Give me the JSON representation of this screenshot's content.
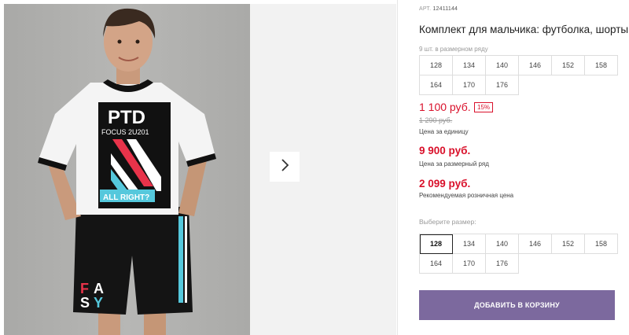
{
  "product": {
    "article_label": "АРТ.",
    "article": "12411144",
    "title": "Комплект для мальчика: футболка, шорты"
  },
  "pack": {
    "note": "9 шт. в размерном ряду",
    "sizes": [
      "128",
      "134",
      "140",
      "146",
      "152",
      "158",
      "164",
      "170",
      "176"
    ]
  },
  "prices": {
    "unit_price": "1 100 руб.",
    "discount": "15%",
    "old_price": "1 290 руб.",
    "unit_label": "Цена за единицу",
    "pack_price": "9 900 руб.",
    "pack_label": "Цена за размерный ряд",
    "retail_price": "2 099 руб.",
    "retail_label": "Рекомендуемая розничная цена"
  },
  "size_select": {
    "label": "Выберите размер:",
    "sizes": [
      "128",
      "134",
      "140",
      "146",
      "152",
      "158",
      "164",
      "170",
      "176"
    ],
    "selected": "128"
  },
  "actions": {
    "add_to_cart": "ДОБАВИТЬ В КОРЗИНУ"
  },
  "print": {
    "tshirt_logo": "PTD",
    "tshirt_line": "FOCUS 2U201",
    "tshirt_slogan": "ALL RIGHT?",
    "shorts_letters": "FA SY"
  },
  "colors": {
    "price_red": "#d9112b",
    "button_purple": "#7c699e"
  },
  "icons": {
    "next": "chevron-right-icon"
  }
}
